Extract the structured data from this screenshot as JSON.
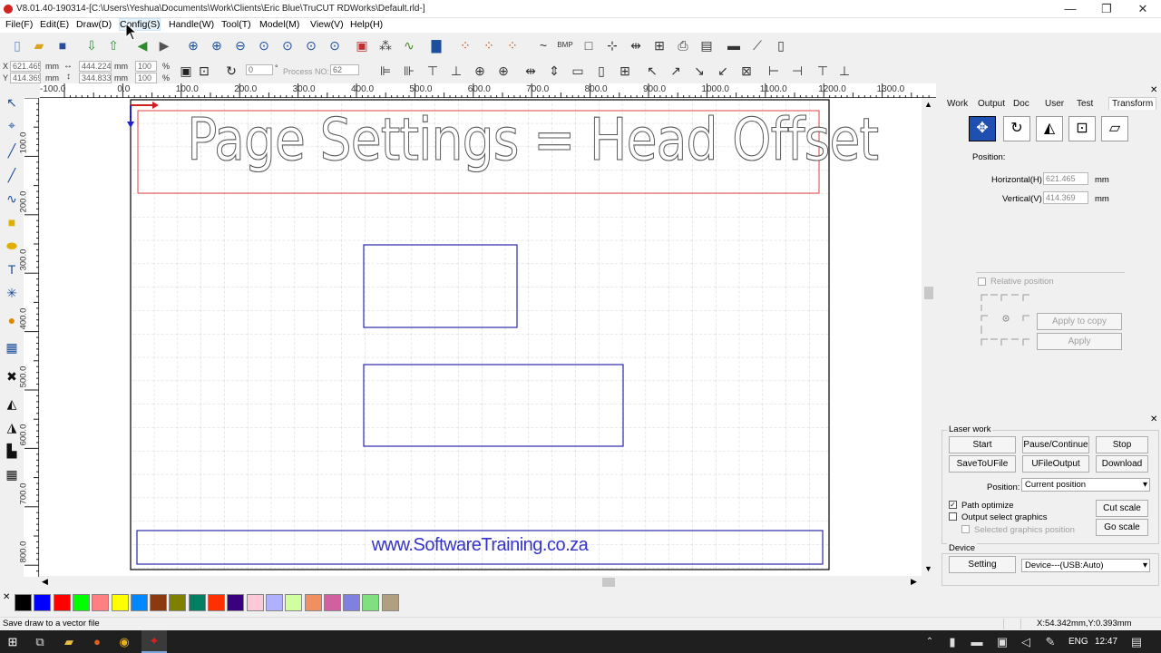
{
  "window": {
    "title": "V8.01.40-190314-[C:\\Users\\Yeshua\\Documents\\Work\\Clients\\Eric Blue\\TruCUT RDWorks\\Default.rld-]",
    "minimize": "—",
    "maximize": "❐",
    "close": "✕"
  },
  "menu": [
    "File(F)",
    "Edit(E)",
    "Draw(D)",
    "Config(S)",
    "Handle(W)",
    "Tool(T)",
    "Model(M)",
    "View(V)",
    "Help(H)"
  ],
  "coords": {
    "x_label": "X",
    "y_label": "Y",
    "x": "621.465",
    "y": "414.369",
    "unit": "mm",
    "width": "444.224",
    "height": "344.833",
    "scale_x": "100",
    "scale_y": "100",
    "percent": "%",
    "rotate": "0",
    "degree": "°",
    "process_label": "Process NO:",
    "process_no": "62"
  },
  "ruler": {
    "h_ticks": [
      "-100.0",
      "0.0",
      "100.0",
      "200.0",
      "300.0",
      "400.0",
      "500.0",
      "600.0",
      "700.0",
      "800.0",
      "900.0",
      "1000.0",
      "1100.0",
      "1200.0",
      "1300.0"
    ],
    "v_ticks": [
      "100.0",
      "200.0",
      "300.0",
      "400.0",
      "500.0",
      "600.0",
      "700.0",
      "800.0"
    ]
  },
  "canvas": {
    "headline": "Page Settings = Head Offset",
    "website": "www.SoftwareTraining.co.za"
  },
  "palette": [
    "#000000",
    "#0000ff",
    "#ff0000",
    "#00ff00",
    "#ff8080",
    "#ffff00",
    "#0088ff",
    "#8b3a0f",
    "#808000",
    "#008060",
    "#ff3000",
    "#3a0080",
    "#ffc8d8",
    "#b0b0ff",
    "#d0ffa0",
    "#f09060",
    "#d060a0",
    "#8080e0",
    "#80e080",
    "#b0a080"
  ],
  "panel": {
    "tabs": [
      "Work",
      "Output",
      "Doc",
      "User",
      "Test",
      "Transform"
    ],
    "position_label": "Position:",
    "horizontal_label": "Horizontal(H)",
    "horizontal_value": "621.465",
    "vertical_label": "Vertical(V)",
    "vertical_value": "414.369",
    "unit": "mm",
    "relative_position": "Relative position",
    "apply_to_copy": "Apply to copy",
    "apply": "Apply"
  },
  "laser": {
    "title": "Laser work",
    "start": "Start",
    "pause": "Pause/Continue",
    "stop": "Stop",
    "save_to_ufile": "SaveToUFile",
    "ufile_output": "UFileOutput",
    "download": "Download",
    "position_label": "Position:",
    "position_value": "Current position",
    "path_optimize": "Path optimize",
    "output_select": "Output select graphics",
    "selected_position": "Selected graphics position",
    "cut_scale": "Cut scale",
    "go_scale": "Go scale",
    "device_title": "Device",
    "setting": "Setting",
    "device_value": "Device---(USB:Auto)"
  },
  "status": {
    "message": "Save draw to a vector file",
    "coords": "X:54.342mm,Y:0.393mm"
  },
  "taskbar": {
    "lang": "ENG",
    "time": "12:47"
  }
}
